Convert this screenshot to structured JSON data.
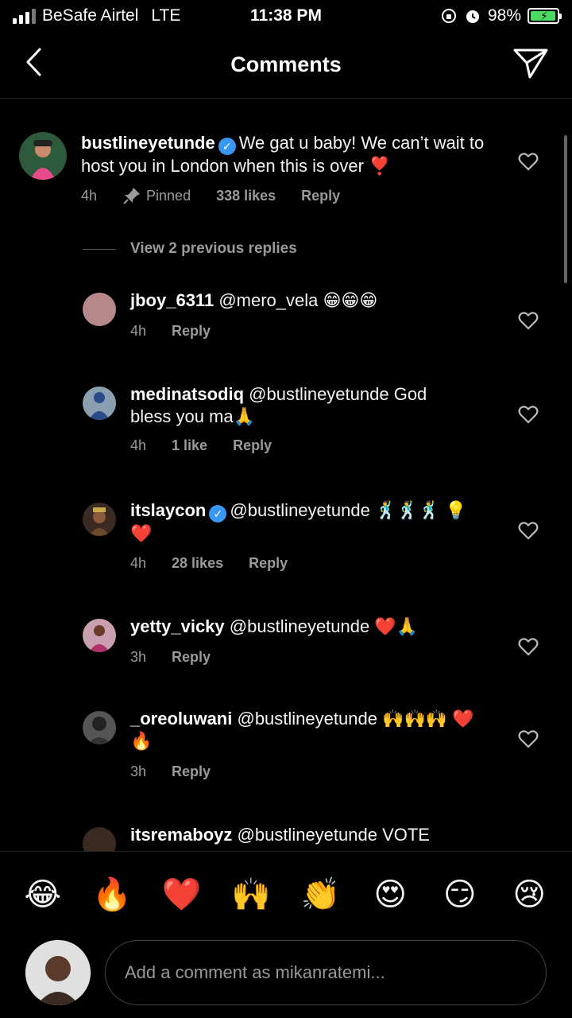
{
  "status": {
    "carrier": "BeSafe Airtel",
    "network": "LTE",
    "time": "11:38 PM",
    "battery": "98%",
    "battery_level": 0.98
  },
  "header": {
    "title": "Comments"
  },
  "comments": [
    {
      "username": "bustlineyetunde",
      "verified": true,
      "text": "We gat u baby! We can’t wait to host you in London when this is over ❣️",
      "time": "4h",
      "pinned": "Pinned",
      "likes": "338 likes",
      "reply": "Reply"
    },
    {
      "username": "jboy_6311",
      "text": "@mero_vela 😁😁😁",
      "time": "4h",
      "reply": "Reply"
    },
    {
      "username": "medinatsodiq",
      "text": "@bustlineyetunde God bless you ma🙏",
      "time": "4h",
      "likes": "1 like",
      "reply": "Reply"
    },
    {
      "username": "itslaycon",
      "verified": true,
      "text": "@bustlineyetunde 🕺🕺🕺 💡❤️",
      "time": "4h",
      "likes": "28 likes",
      "reply": "Reply"
    },
    {
      "username": "yetty_vicky",
      "text": "@bustlineyetunde ❤️🙏",
      "time": "3h",
      "reply": "Reply"
    },
    {
      "username": "_oreoluwani",
      "text": "@bustlineyetunde 🙌🙌🙌 ❤️🔥",
      "time": "3h",
      "reply": "Reply"
    },
    {
      "username": "itsremaboyz",
      "text": "@bustlineyetunde VOTE",
      "time": "",
      "reply": ""
    }
  ],
  "view_replies": "View 2 previous replies",
  "emoji_bar": [
    "😂",
    "🔥",
    "❤️",
    "🙌",
    "👏",
    "😍",
    "😏",
    "😢"
  ],
  "input": {
    "placeholder": "Add a comment as mikanratemi..."
  },
  "colors": {
    "background": "#000000",
    "secondary_text": "#9a9a9a",
    "verified": "#3897f0",
    "battery": "#4cd964"
  }
}
